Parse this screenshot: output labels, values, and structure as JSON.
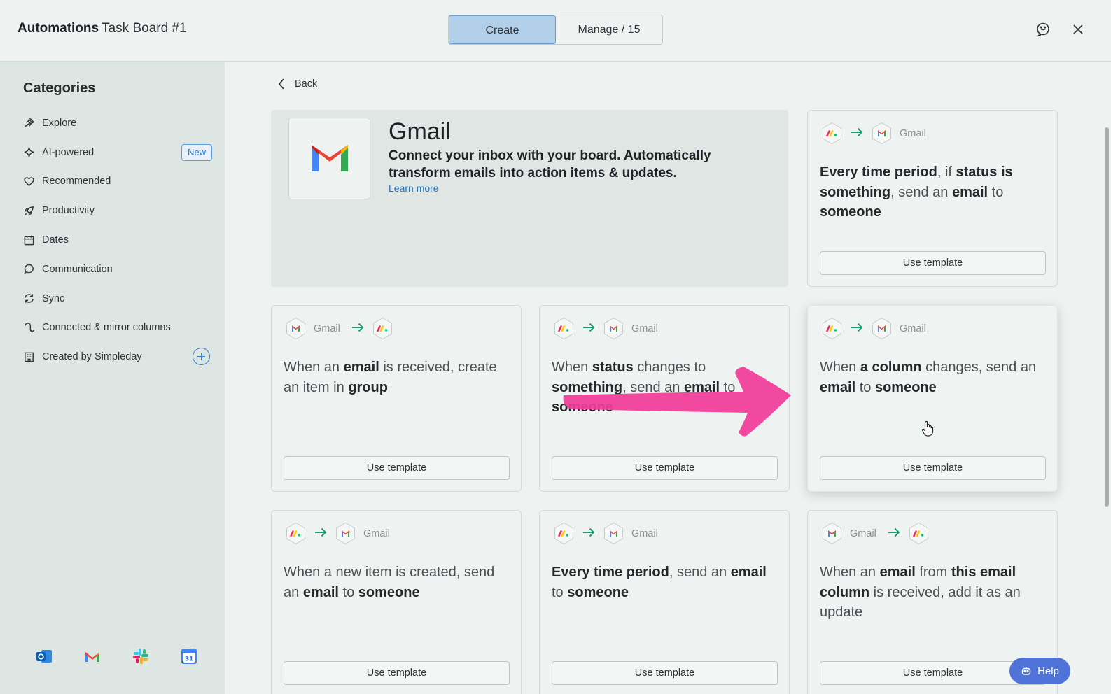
{
  "header": {
    "app_name": "Automations",
    "board_name": "Task Board #1",
    "tabs": {
      "create": "Create",
      "manage": "Manage / 15"
    }
  },
  "sidebar": {
    "title": "Categories",
    "items": [
      {
        "label": "Explore",
        "icon": "pin-icon"
      },
      {
        "label": "AI-powered",
        "icon": "sparkle-icon",
        "badge": "New"
      },
      {
        "label": "Recommended",
        "icon": "heart-icon"
      },
      {
        "label": "Productivity",
        "icon": "rocket-icon"
      },
      {
        "label": "Dates",
        "icon": "calendar-icon"
      },
      {
        "label": "Communication",
        "icon": "chat-bubble-icon"
      },
      {
        "label": "Sync",
        "icon": "sync-icon"
      },
      {
        "label": "Connected & mirror columns",
        "icon": "connect-icon"
      },
      {
        "label": "Created by Simpleday",
        "icon": "building-icon"
      }
    ],
    "apps": [
      "outlook-icon",
      "gmail-icon",
      "slack-icon",
      "google-calendar-icon"
    ]
  },
  "main": {
    "back_label": "Back",
    "hero": {
      "title": "Gmail",
      "description": "Connect your inbox with your board. Automatically transform emails into action items & updates.",
      "link": "Learn more"
    },
    "use_template_label": "Use template",
    "flow_label": "Gmail",
    "cards": [
      {
        "flow": "monday-to-gmail",
        "text": [
          [
            "b",
            "Every time period"
          ],
          [
            "n",
            ", if "
          ],
          [
            "b",
            "status is something"
          ],
          [
            "n",
            ", send an "
          ],
          [
            "b",
            "email"
          ],
          [
            "n",
            " to "
          ],
          [
            "b",
            "someone"
          ]
        ]
      },
      {
        "flow": "gmail-to-monday",
        "text": [
          [
            "n",
            "When an "
          ],
          [
            "b",
            "email"
          ],
          [
            "n",
            " is received, create an item in "
          ],
          [
            "b",
            "group"
          ]
        ]
      },
      {
        "flow": "monday-to-gmail",
        "text": [
          [
            "n",
            "When "
          ],
          [
            "b",
            "status"
          ],
          [
            "n",
            " changes to "
          ],
          [
            "b",
            "something"
          ],
          [
            "n",
            ", send an "
          ],
          [
            "b",
            "email"
          ],
          [
            "n",
            " to "
          ],
          [
            "b",
            "someone"
          ]
        ]
      },
      {
        "flow": "monday-to-gmail",
        "text": [
          [
            "n",
            "When "
          ],
          [
            "b",
            "a column"
          ],
          [
            "n",
            " changes, send an "
          ],
          [
            "b",
            "email"
          ],
          [
            "n",
            " to "
          ],
          [
            "b",
            "someone"
          ]
        ]
      },
      {
        "flow": "monday-to-gmail",
        "text": [
          [
            "n",
            "When a new item is created, send an "
          ],
          [
            "b",
            "email"
          ],
          [
            "n",
            " to "
          ],
          [
            "b",
            "someone"
          ]
        ]
      },
      {
        "flow": "monday-to-gmail",
        "text": [
          [
            "b",
            "Every time period"
          ],
          [
            "n",
            ", send an "
          ],
          [
            "b",
            "email"
          ],
          [
            "n",
            " to "
          ],
          [
            "b",
            "someone"
          ]
        ]
      },
      {
        "flow": "gmail-to-monday",
        "text": [
          [
            "n",
            "When an "
          ],
          [
            "b",
            "email"
          ],
          [
            "n",
            " from "
          ],
          [
            "b",
            "this email column"
          ],
          [
            "n",
            " is received, add it as an update"
          ]
        ]
      }
    ]
  },
  "help_label": "Help",
  "colors": {
    "accent": "#4f73d9",
    "selected_tab": "#b3d0ea",
    "annotation_arrow": "#f23c9a",
    "link": "#1f76c2"
  }
}
